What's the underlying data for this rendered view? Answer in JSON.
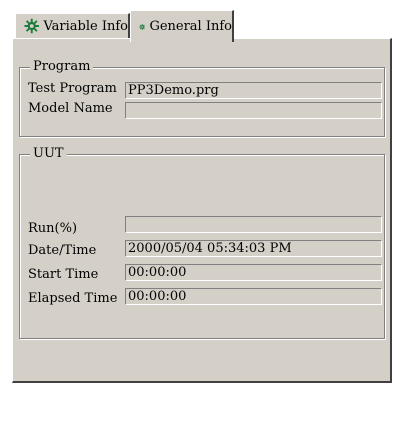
{
  "tabs": [
    {
      "label": "Variable Info",
      "icon": "gear-icon",
      "active": false
    },
    {
      "label": "General Info",
      "icon": "gear-icon",
      "active": true
    }
  ],
  "program": {
    "title": "Program",
    "test_program_label": "Test Program",
    "test_program_value": "PP3Demo.prg",
    "model_name_label": "Model Name",
    "model_name_value": ""
  },
  "uut": {
    "title": "UUT",
    "run_label": "Run(%)",
    "run_value": "",
    "datetime_label": "Date/Time",
    "datetime_value": "2000/05/04 05:34:03 PM",
    "start_label": "Start Time",
    "start_value": "00:00:00",
    "elapsed_label": "Elapsed Time",
    "elapsed_value": "00:00:00"
  },
  "colors": {
    "face": "#d4d0c8",
    "icon": "#1a7a3a"
  }
}
